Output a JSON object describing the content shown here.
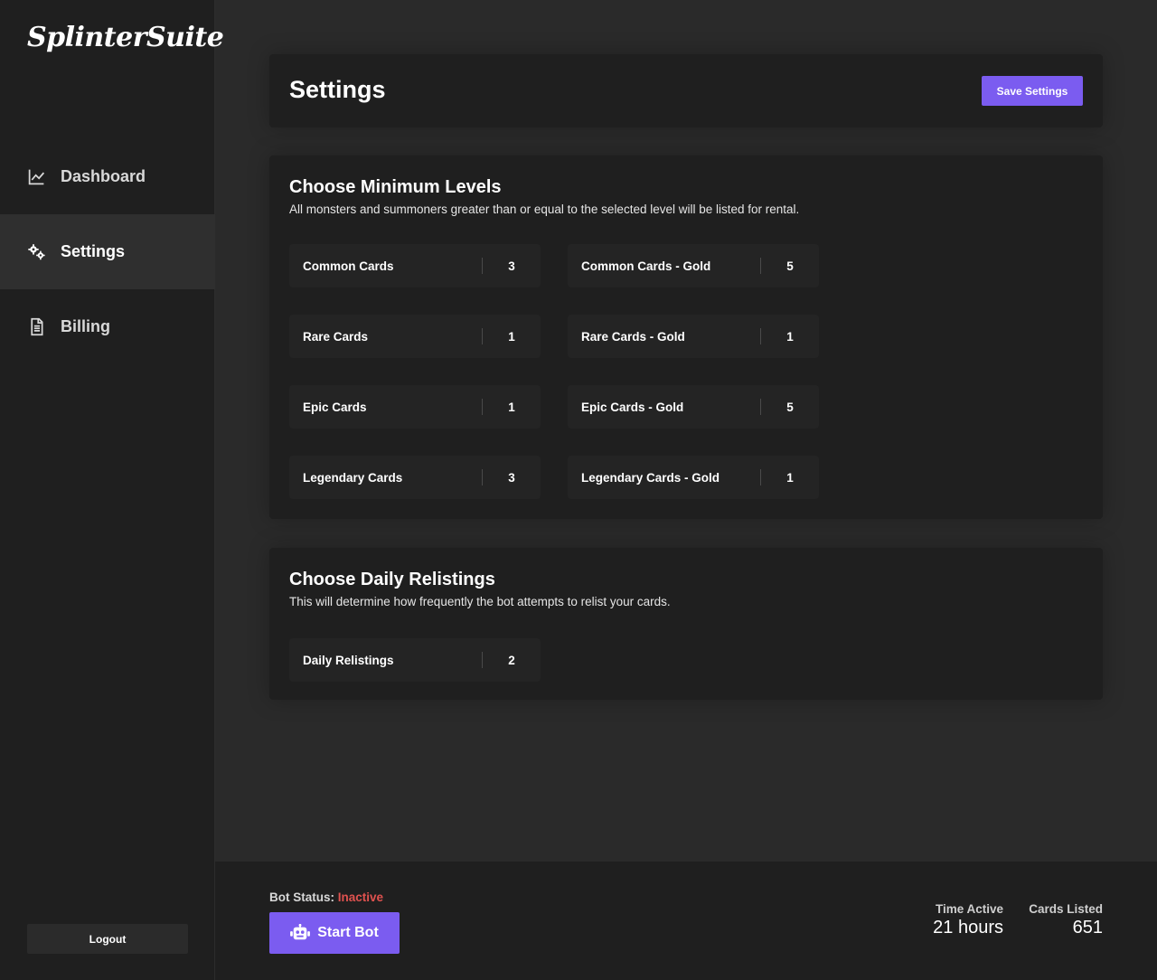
{
  "app": {
    "logo": "SplinterSuite"
  },
  "sidebar": {
    "items": [
      {
        "label": "Dashboard",
        "icon": "line-chart-icon",
        "active": false
      },
      {
        "label": "Settings",
        "icon": "gears-icon",
        "active": true
      },
      {
        "label": "Billing",
        "icon": "invoice-icon",
        "active": false
      }
    ],
    "logout_label": "Logout"
  },
  "header": {
    "title": "Settings",
    "save_label": "Save Settings"
  },
  "levels": {
    "title": "Choose Minimum Levels",
    "description": "All monsters and summoners greater than or equal to the selected level will be listed for rental.",
    "fields": [
      {
        "label": "Common Cards",
        "value": "3"
      },
      {
        "label": "Common Cards - Gold",
        "value": "5"
      },
      {
        "label": "Rare Cards",
        "value": "1"
      },
      {
        "label": "Rare Cards - Gold",
        "value": "1"
      },
      {
        "label": "Epic Cards",
        "value": "1"
      },
      {
        "label": "Epic Cards - Gold",
        "value": "5"
      },
      {
        "label": "Legendary Cards",
        "value": "3"
      },
      {
        "label": "Legendary Cards - Gold",
        "value": "1"
      }
    ]
  },
  "relistings": {
    "title": "Choose Daily Relistings",
    "description": "This will determine how frequently the bot attempts to relist your cards.",
    "field": {
      "label": "Daily Relistings",
      "value": "2"
    }
  },
  "footer": {
    "status_label": "Bot Status:",
    "status_value": "Inactive",
    "start_label": "Start Bot",
    "time_active_label": "Time Active",
    "time_active_value": "21 hours",
    "cards_listed_label": "Cards Listed",
    "cards_listed_value": "651"
  },
  "colors": {
    "accent": "#7b5cf0",
    "inactive": "#e0524f",
    "background": "#2a2a2a",
    "panel": "#1f1f1f"
  }
}
